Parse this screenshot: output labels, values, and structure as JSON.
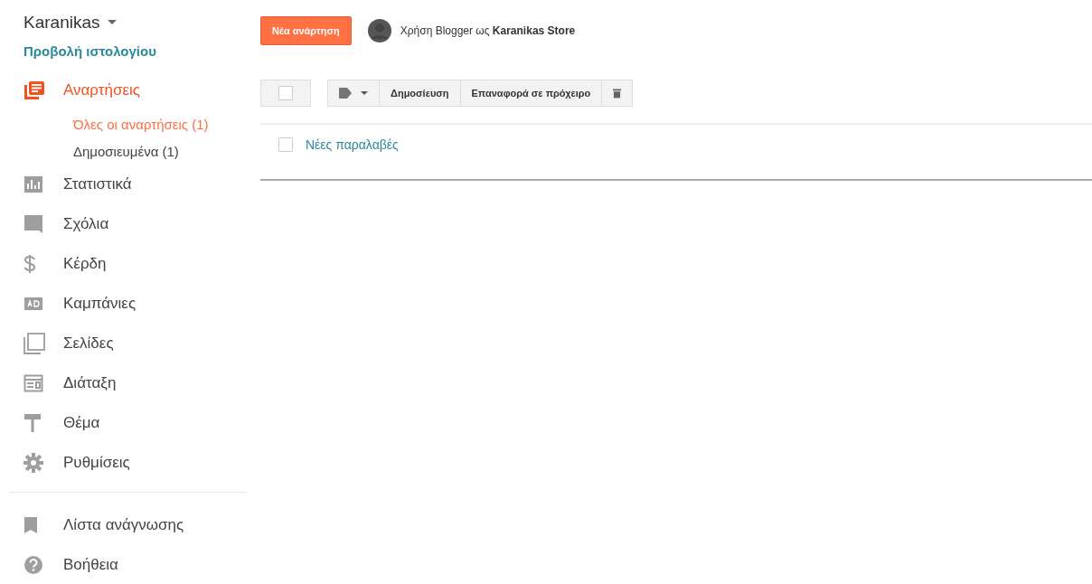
{
  "blog": {
    "title": "Karanikas",
    "view_link": "Προβολή ιστολογίου"
  },
  "nav": [
    {
      "label": "Αναρτήσεις",
      "selected": true,
      "children": [
        {
          "label": "Όλες οι αναρτήσεις (1)",
          "selected": true
        },
        {
          "label": "Δημοσιευμένα (1)",
          "selected": false
        }
      ]
    },
    {
      "label": "Στατιστικά",
      "selected": false
    },
    {
      "label": "Σχόλια",
      "selected": false
    },
    {
      "label": "Κέρδη",
      "selected": false
    },
    {
      "label": "Καμπάνιες",
      "selected": false
    },
    {
      "label": "Σελίδες",
      "selected": false
    },
    {
      "label": "Διάταξη",
      "selected": false
    },
    {
      "label": "Θέμα",
      "selected": false
    },
    {
      "label": "Ρυθμίσεις",
      "selected": false
    }
  ],
  "secondary_nav": [
    {
      "label": "Λίστα ανάγνωσης",
      "selected": false
    },
    {
      "label": "Βοήθεια",
      "selected": false
    }
  ],
  "new_post_button": "Νέα ανάρτηση",
  "user_line": "Χρήση Blogger ως **Karanikas Store**",
  "toolbar": {
    "select_all_checked": false,
    "buttons": [
      "Δημοσίευση",
      "Επαναφορά σε πρόχειρο"
    ]
  },
  "posts": [
    {
      "title": "Νέες παραλαβές",
      "checked": false
    }
  ]
}
